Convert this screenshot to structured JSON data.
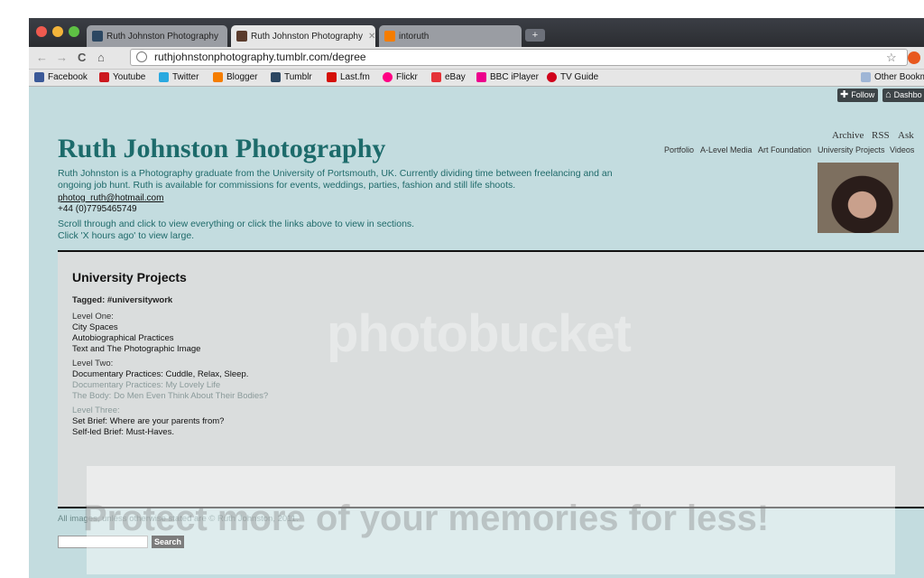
{
  "browser": {
    "tabs": [
      {
        "label": "Ruth Johnston Photography",
        "favicon": "tumblr-icon",
        "active": false
      },
      {
        "label": "Ruth Johnston Photography",
        "favicon": "avatar-icon",
        "active": true
      },
      {
        "label": "intoruth",
        "favicon": "blogger-icon",
        "active": false
      }
    ],
    "new_tab": "+",
    "url": "ruthjohnstonphotography.tumblr.com/degree",
    "bookmarks": [
      {
        "label": "Facebook",
        "icon": "facebook-icon",
        "color": "#3b5998"
      },
      {
        "label": "Youtube",
        "icon": "youtube-icon",
        "color": "#cc181e"
      },
      {
        "label": "Twitter",
        "icon": "twitter-icon",
        "color": "#2aa9e0"
      },
      {
        "label": "Blogger",
        "icon": "blogger-icon",
        "color": "#f57d00"
      },
      {
        "label": "Tumblr",
        "icon": "tumblr-icon",
        "color": "#2c4762"
      },
      {
        "label": "Last.fm",
        "icon": "lastfm-icon",
        "color": "#d51007"
      },
      {
        "label": "Flickr",
        "icon": "flickr-icon",
        "color": "#ff0084"
      },
      {
        "label": "eBay",
        "icon": "ebay-icon",
        "color": "#e53238"
      },
      {
        "label": "BBC iPlayer",
        "icon": "iplayer-icon",
        "color": "#ec008c"
      },
      {
        "label": "TV Guide",
        "icon": "heart-icon",
        "color": "#d0021b"
      }
    ],
    "other_bookmarks": "Other Bookm"
  },
  "tumblr_controls": {
    "follow": "Follow",
    "dashboard": "Dashbo"
  },
  "header": {
    "title": "Ruth Johnston Photography",
    "description": "Ruth Johnston is a Photography graduate from the University of Portsmouth, UK. Currently dividing time between freelancing and an ongoing job hunt. Ruth is available for commissions for events, weddings, parties, fashion and still life shoots.",
    "email": "photog_ruth@hotmail.com",
    "phone": "+44 (0)7795465749",
    "scroll_hint_1": "Scroll through and click to view everything or click the links above to view in sections.",
    "scroll_hint_2": "Click 'X hours ago' to view large.",
    "top_links": [
      "Archive",
      "RSS",
      "Ask"
    ],
    "nav": [
      "Portfolio",
      "A-Level Media",
      "Art Foundation",
      "University Projects",
      "Videos"
    ]
  },
  "post": {
    "heading": "University Projects",
    "tagged": "Tagged: #universitywork",
    "level1": "Level One:",
    "level1_items": [
      "City Spaces",
      "Autobiographical Practices",
      "Text and The Photographic Image"
    ],
    "level2": "Level Two:",
    "level2_items": [
      "Documentary Practices: Cuddle, Relax, Sleep.",
      "Documentary Practices: My Lovely Life",
      "The Body: Do Men Even Think About Their Bodies?"
    ],
    "level3": "Level Three:",
    "level3_items": [
      "Set Brief: Where are your parents from?",
      "Self-led Brief: Must-Haves."
    ]
  },
  "footer": {
    "copyright": "All images, unless otherwise stated are © Ruth Johnston, 2011.",
    "search_button": "Search",
    "search_value": ""
  },
  "watermark": {
    "logo": "photobucket",
    "text": "Protect more of your memories for less!"
  }
}
